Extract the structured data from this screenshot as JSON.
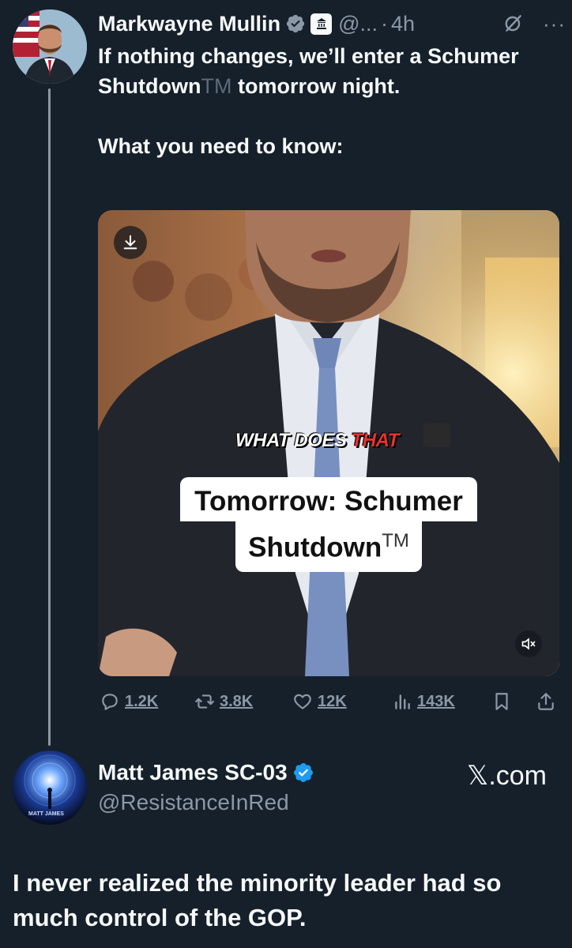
{
  "tweet1": {
    "author_name": "Markwayne Mullin",
    "handle": "@...",
    "separator": "·",
    "time": "4h",
    "text": {
      "line1": "If nothing changes, we’ll enter a Schumer Shutdown",
      "tm": "TM",
      "line1_end": " tomorrow night.",
      "line2": "What you need to know:"
    },
    "media": {
      "caption_top_white": "WHAT DOES ",
      "caption_top_red": "THAT",
      "caption_line1": "Tomorrow: Schumer",
      "caption_line2": "Shutdown",
      "caption_tm": "TM"
    },
    "stats": {
      "replies": "1.2K",
      "reposts": "3.8K",
      "likes": "12K",
      "views": "143K"
    }
  },
  "tweet2": {
    "author_name": "Matt James SC-03",
    "handle": "@ResistanceInRed",
    "source_label": "𝕏.com",
    "avatar_text": "MATT JAMES",
    "text": "I never realized the minority leader had so much control of the GOP."
  },
  "colors": {
    "background": "#15202b",
    "muted": "#8b98a5",
    "verified": "#1d9bf0",
    "caption_red": "#e8322f"
  },
  "icons": [
    "verified-icon",
    "government-icon",
    "grok-icon",
    "more-icon",
    "download-icon",
    "mute-icon",
    "reply-icon",
    "retweet-icon",
    "like-icon",
    "views-icon",
    "bookmark-icon",
    "share-icon"
  ]
}
